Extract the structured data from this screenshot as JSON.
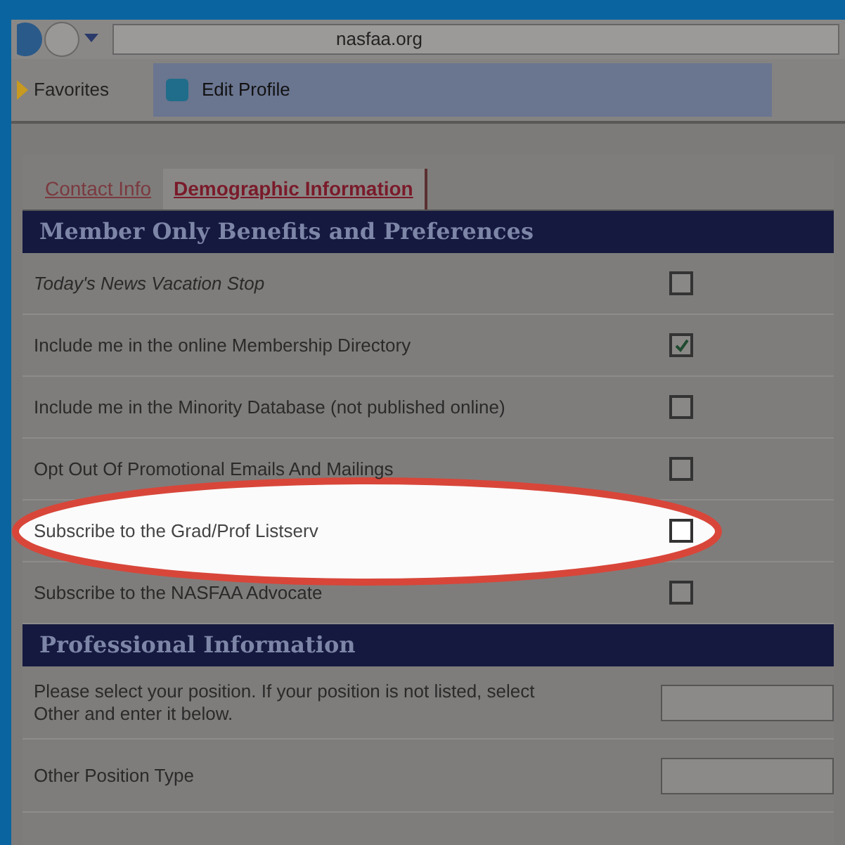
{
  "browser": {
    "address": "nasfaa.org",
    "favorites": "Favorites",
    "tab": "Edit Profile"
  },
  "tabs": [
    {
      "label": "Contact Info",
      "selected": false
    },
    {
      "label": "Demographic Information",
      "selected": true
    }
  ],
  "sections": [
    {
      "title": "Member Only Benefits and Preferences",
      "rows": [
        {
          "kind": "checkbox",
          "label": "Today's News Vacation Stop",
          "italic": true,
          "checked": false,
          "highlighted": false
        },
        {
          "kind": "checkbox",
          "label": "Include me in the online Membership Directory",
          "italic": false,
          "checked": true,
          "highlighted": false
        },
        {
          "kind": "checkbox",
          "label": "Include me in the Minority Database (not published online)",
          "italic": false,
          "checked": false,
          "highlighted": false
        },
        {
          "kind": "checkbox",
          "label": "Opt Out Of Promotional Emails And Mailings",
          "italic": false,
          "checked": false,
          "highlighted": false
        },
        {
          "kind": "checkbox",
          "label": "Subscribe to the Grad/Prof Listserv",
          "italic": false,
          "checked": false,
          "highlighted": true
        },
        {
          "kind": "checkbox",
          "label": "Subscribe to the NASFAA Advocate",
          "italic": false,
          "checked": false,
          "highlighted": false
        }
      ]
    },
    {
      "title": "Professional Information",
      "rows": [
        {
          "kind": "field",
          "label": "Please select your position. If your position is not listed, select Other and enter it below."
        },
        {
          "kind": "field",
          "label": "Other Position Type"
        }
      ]
    }
  ]
}
